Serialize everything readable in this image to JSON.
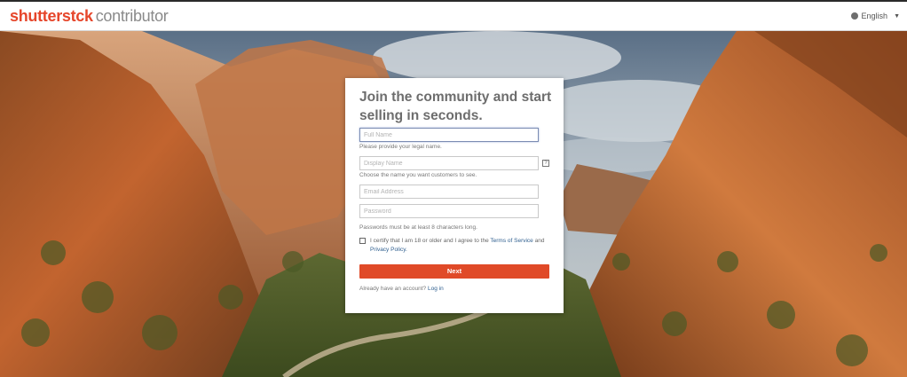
{
  "header": {
    "brand": "shutterstck",
    "brand_sub": "contributor",
    "language": "English",
    "language_icon": "globe-icon"
  },
  "signup": {
    "title": "Join the community and start selling in seconds.",
    "full_name_placeholder": "Full Name",
    "full_name_hint": "Please provide your legal name.",
    "display_name_placeholder": "Display Name",
    "display_name_hint": "Choose the name you want customers to see.",
    "email_placeholder": "Email Address",
    "password_placeholder": "Password",
    "password_hint": "Passwords must be at least 8 characters long.",
    "help_symbol": "?",
    "agree_text": "I certify that I am 18 or older and I agree to the",
    "terms_link": "Terms of Service",
    "and_text": "and",
    "privacy_link": "Privacy Policy.",
    "next_label": "Next",
    "login_prompt": "Already have an account?",
    "login_link": "Log in"
  },
  "colors": {
    "brand": "#e6462b",
    "button": "#e04a28",
    "link": "#2f5f8f"
  }
}
